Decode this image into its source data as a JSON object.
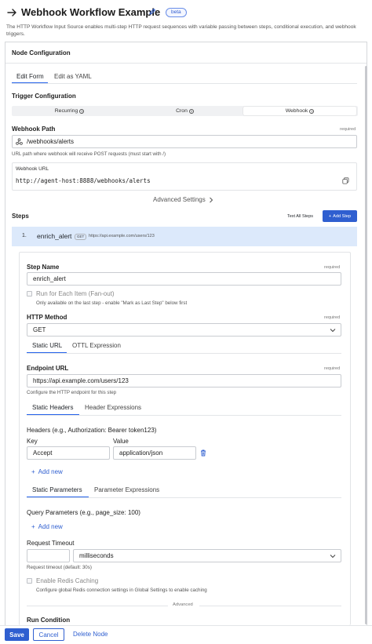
{
  "header": {
    "title": "Webhook Workflow Example",
    "badge": "beta",
    "description": "The HTTP Workflow Input Source enables multi-step HTTP request sequences with variable passing between steps, conditional execution, and webhook triggers."
  },
  "panel": {
    "title": "Node Configuration",
    "tabs": [
      "Edit Form",
      "Edit as YAML"
    ],
    "active_tab": "Edit Form"
  },
  "trigger": {
    "heading": "Trigger Configuration",
    "options": [
      "Recurring",
      "Cron",
      "Webhook"
    ],
    "selected": "Webhook"
  },
  "webhook_path": {
    "label": "Webhook Path",
    "required": "required",
    "value": "/webhooks/alerts",
    "help": "URL path where webhook will receive POST requests (must start with /)"
  },
  "webhook_url": {
    "label": "Webhook URL",
    "value": "http://agent-host:8888/webhooks/alerts"
  },
  "advanced_settings": "Advanced Settings",
  "steps": {
    "heading": "Steps",
    "text_all_steps": "Text All Steps",
    "add_step": "Add Step",
    "items": [
      {
        "index": "1.",
        "name": "enrich_alert",
        "method": "GET",
        "url": "https://api.example.com/users/123"
      }
    ]
  },
  "step_form": {
    "step_name": {
      "label": "Step Name",
      "required": "required",
      "value": "enrich_alert"
    },
    "fanout": {
      "label": "Run for Each Item (Fan-out)",
      "help": "Only available on the last step - enable \"Mark as Last Step\" below first"
    },
    "http_method": {
      "label": "HTTP Method",
      "required": "required",
      "value": "GET"
    },
    "url_tabs": [
      "Static URL",
      "OTTL Expression"
    ],
    "endpoint": {
      "label": "Endpoint URL",
      "required": "required",
      "value": "https://api.example.com/users/123",
      "help": "Configure the HTTP endpoint for this step"
    },
    "header_tabs": [
      "Static Headers",
      "Header Expressions"
    ],
    "headers": {
      "label": "Headers (e.g., Authorization: Bearer token123)",
      "key_label": "Key",
      "value_label": "Value",
      "rows": [
        {
          "key": "Accept",
          "value": "application/json"
        }
      ],
      "add": "Add new"
    },
    "param_tabs": [
      "Static Parameters",
      "Parameter Expressions"
    ],
    "query": {
      "label": "Query Parameters (e.g., page_size: 100)",
      "add": "Add new"
    },
    "timeout": {
      "label": "Request Timeout",
      "value": "",
      "unit": "milliseconds",
      "help": "Request timeout (default: 30s)"
    },
    "redis": {
      "label": "Enable Redis Caching",
      "help": "Configure global Redis connection settings in Global Settings to enable caching"
    },
    "advanced_divider": "Advanced",
    "run_condition": "Run Condition"
  },
  "footer": {
    "save": "Save",
    "cancel": "Cancel",
    "delete": "Delete Node"
  },
  "colors": {
    "accent": "#2f5fd0",
    "step_highlight": "#dce9fb",
    "badge_border": "#6a8ee8"
  }
}
